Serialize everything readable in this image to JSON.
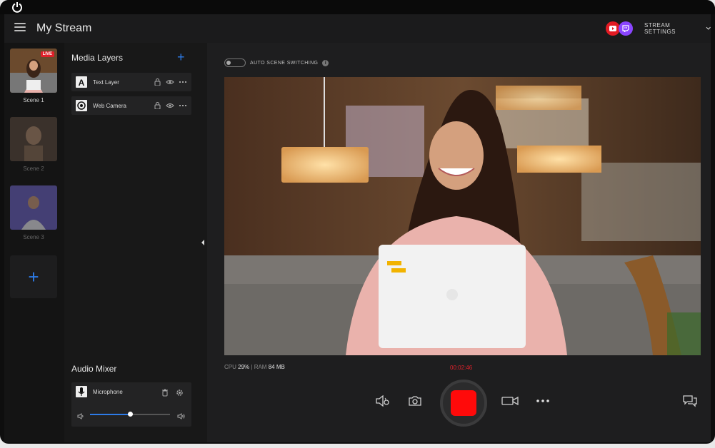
{
  "app": {
    "title": "My Stream"
  },
  "header": {
    "stream_settings_label": "STREAM SETTINGS"
  },
  "scenes": [
    {
      "label": "Scene 1",
      "live_badge": "LIVE"
    },
    {
      "label": "Scene 2"
    },
    {
      "label": "Scene 3"
    }
  ],
  "layers": {
    "title": "Media Layers",
    "items": [
      {
        "name": "Text Layer",
        "icon": "text-layer-icon"
      },
      {
        "name": "Web Camera",
        "icon": "camera-icon"
      }
    ]
  },
  "audio_mixer": {
    "title": "Audio Mixer",
    "microphone": {
      "name": "Microphone",
      "volume": 0.5
    }
  },
  "stage": {
    "auto_scene_label": "AUTO SCENE SWITCHING",
    "stats": {
      "cpu_label": "CPU",
      "cpu_value": "29%",
      "ram_label": "RAM",
      "ram_value": "84 MB"
    },
    "timer": "00:02:46"
  },
  "colors": {
    "accent": "#2d7be8",
    "record": "#ff0a0a",
    "live": "#e0212b",
    "youtube": "#e31b23",
    "twitch": "#8a45ff"
  }
}
